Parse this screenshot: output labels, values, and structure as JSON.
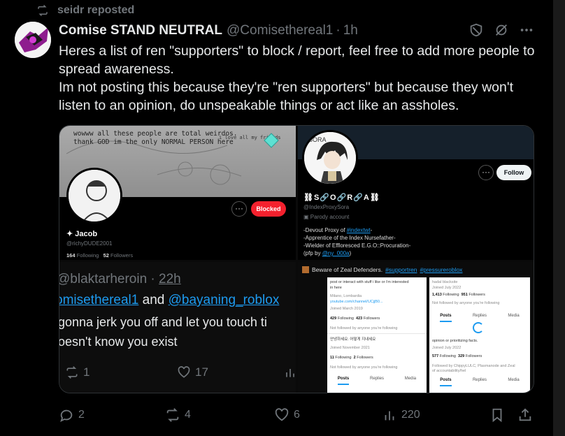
{
  "repost": {
    "label": "seidr reposted"
  },
  "post": {
    "author_name": "Comise STAND NEUTRAL",
    "author_handle": "@Comisethereal1",
    "separator": "·",
    "time": "1h",
    "body_lines": [
      "Heres a list of ren \"supporters\" to block / report, feel free to add more people to spread awareness.",
      "Im not posting this because they're \"ren supporters\" but because they won't listen to an opinion, do unspeakable things or act like an assholes."
    ]
  },
  "media": {
    "top_left": {
      "banner_line1": "wowww all these people are total weirdos.",
      "banner_line2": "thank GOD im the only NORMAL PERSON here",
      "banner_small": "i love all my friends",
      "more": "···",
      "blocked_label": "Blocked",
      "name": "✦ Jacob",
      "handle": "@richyDUDE2001",
      "following_count": "164",
      "following_label": "Following",
      "followers_count": "52",
      "followers_label": "Followers"
    },
    "top_right": {
      "pfp_caption": "SORA",
      "more": "···",
      "follow_label": "Follow",
      "name": "⛓S🔗O🔗R🔗A⛓",
      "handle": "@IndexProxySora",
      "parody": "Parody account",
      "bio_1_prefix": "-Devout Proxy of ",
      "bio_1_link": "#indextwt",
      "bio_1_suffix": "-",
      "bio_2": "-Apprentice of the Index Nursefather-",
      "bio_3": "-Wielder of  Effloresced E.G.O::Procuration-",
      "bio_4_prefix": "(pfp by ",
      "bio_4_link": "@ny_000a",
      "bio_4_suffix": ")"
    },
    "bottom_left": {
      "handle": "@blaktarheroin",
      "separator": "·",
      "time": "22h",
      "mention1": "omisethereal1",
      "and": "and",
      "mention2": "@bayaning_roblox",
      "text1": "gonna jerk you off and let you touch ti",
      "text2": "oesn't know you exist",
      "reposts": "1",
      "likes": "17"
    },
    "bottom_right": {
      "topline_prefix": "Beware of Zeal Defenders.",
      "tag1": "#supportren",
      "tag2": "#pressureroblox",
      "left_card": {
        "line1": "post or interact with stuff i like or i'm interested",
        "line2": "in here",
        "location": "Milano, Lombardia",
        "link": "youtube.com/channel/UCjjB0...",
        "joined1": "Joined March 2019",
        "stats1_following": "429",
        "stats1_following_label": "Following",
        "stats1_followers": "423",
        "stats1_followers_label": "Followers",
        "notfollowed1": "Not followed by anyone you're following",
        "korean": "안녕하세요. 어떻게 지내세요",
        "joined2": "Joined November 2021",
        "stats2_following": "11",
        "stats2_following_label": "Following",
        "stats2_followers": "2",
        "stats2_followers_label": "Followers",
        "notfollowed2": "Not followed by anyone you're following",
        "tabs": [
          "Posts",
          "Replies",
          "Media"
        ]
      },
      "right_card": {
        "line1": "hadal blacksite",
        "joined1": "Joined July 2022",
        "stats1_following": "1,413",
        "stats1_following_label": "Following",
        "stats1_followers": "951",
        "stats1_followers_label": "Followers",
        "notfollowed1": "Not followed by anyone you're following",
        "tabs": [
          "Posts",
          "Replies",
          "Media"
        ],
        "bio2": "opinion or prioritizing facts.",
        "joined2": "Joined July 2022",
        "stats2_following": "577",
        "stats2_following_label": "Following",
        "stats2_followers": "329",
        "stats2_followers_label": "Followers",
        "followed_by": "Followed by ChippyLULC, Plasmanode and Zeal",
        "followed_by2": "of accountability/hel"
      }
    }
  },
  "actions": {
    "replies": "2",
    "reposts": "4",
    "likes": "6",
    "views": "220"
  },
  "colors": {
    "background": "#000000",
    "text": "#e7e9ea",
    "muted": "#71767b",
    "accent": "#1d9bf0",
    "blocked": "#f4212e"
  },
  "icons": [
    "repost-icon",
    "avatar",
    "block-icon",
    "grok-icon",
    "more-icon",
    "reply-icon",
    "like-icon",
    "views-icon",
    "bookmark-icon",
    "share-icon"
  ]
}
